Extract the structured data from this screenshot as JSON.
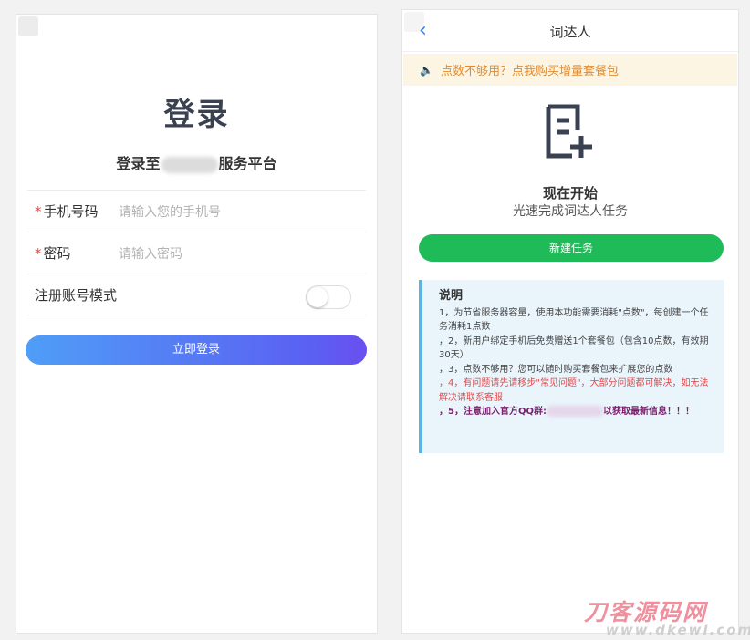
{
  "login": {
    "title": "登录",
    "subtitle_prefix": "登录至",
    "subtitle_suffix": "服务平台",
    "phone_label": "手机号码",
    "phone_placeholder": "请输入您的手机号",
    "password_label": "密码",
    "password_placeholder": "请输入密码",
    "register_label": "注册账号模式",
    "register_toggle_on": false,
    "submit_label": "立即登录",
    "required_mark": "*"
  },
  "task": {
    "header_title": "词达人",
    "back_icon": "chevron-left-icon",
    "notice_icon": "speaker-icon",
    "notice_text": "点数不够用？点我购买增量套餐包",
    "start_icon": "document-add-icon",
    "start_title": "现在开始",
    "start_subtitle": "光速完成词达人任务",
    "new_task_label": "新建任务",
    "info_title": "说明",
    "info_items": [
      "1，为节省服务器容量，使用本功能需要消耗\"点数\"，每创建一个任务消耗1点数",
      "，2，新用户绑定手机后免费赠送1个套餐包（包含10点数，有效期30天）",
      "，3，点数不够用？您可以随时购买套餐包来扩展您的点数",
      "，4，有问题请先请移步\"常见问题\"，大部分问题都可解决，如无法解决请联系客服",
      "，5，注意加入官方QQ群:",
      "以获取最新信息！！！"
    ]
  },
  "watermark": {
    "cn": "刀客源码网",
    "url": "www.dkewl.com"
  },
  "colors": {
    "green": "#1fbb59",
    "blue_start": "#4f9ef7",
    "purple_end": "#6a4ff0",
    "notice_text": "#e58b2b",
    "required": "#e24a4a"
  }
}
